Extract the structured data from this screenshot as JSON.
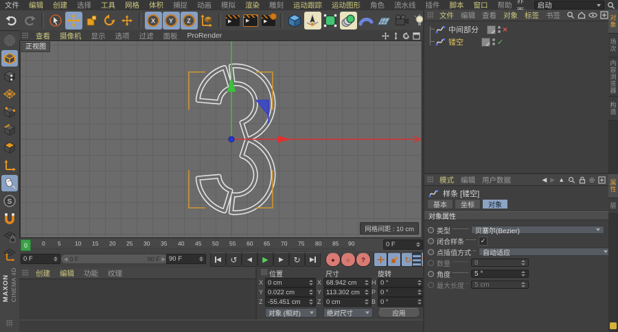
{
  "colors": {
    "accent_orange": "#d79b35",
    "selection_blue": "#87a0c4",
    "menu_highlight": "#cdc87e",
    "viewport_bg": "#6b6b6b",
    "axis_green": "#3fbf3f",
    "axis_red": "#e03030"
  },
  "menubar": {
    "items": [
      "文件",
      "编辑",
      "创建",
      "选择",
      "工具",
      "网格",
      "体积",
      "捕捉",
      "动画",
      "模拟",
      "渲染",
      "雕刻",
      "运动跟踪",
      "运动图形",
      "角色",
      "流水线",
      "插件",
      "脚本",
      "窗口",
      "帮助"
    ],
    "interface_label": "界面:",
    "interface_value": "启动"
  },
  "viewport": {
    "menu": [
      "查看",
      "摄像机",
      "显示",
      "选项",
      "过滤",
      "面板",
      "ProRender"
    ],
    "view_label": "正视图",
    "grid_spacing_label": "网格间距 : 10 cm"
  },
  "object_manager": {
    "menu": [
      "文件",
      "编辑",
      "查看",
      "对象",
      "标签",
      "书签"
    ],
    "objects": [
      {
        "name": "中间部分"
      },
      {
        "name": "镂空"
      }
    ],
    "side_tabs": [
      "对象",
      "场次",
      "内容浏览器",
      "构造"
    ]
  },
  "attribute_manager": {
    "menu": [
      "模式",
      "编辑",
      "用户数据"
    ],
    "title": "样条 [镂空]",
    "tabs": [
      "基本",
      "坐标",
      "对象"
    ],
    "section": "对象属性",
    "rows": [
      {
        "label": "类型",
        "value": "贝塞尔(Bezier)"
      },
      {
        "label": "闭合样条",
        "value": "✓"
      },
      {
        "label": "点插值方式",
        "value": "自动适应"
      },
      {
        "label": "数量",
        "value": "8"
      },
      {
        "label": "角度",
        "value": "5 °"
      },
      {
        "label": "最大长度",
        "value": "5 cm"
      }
    ],
    "side_tabs": [
      "属性",
      "层"
    ]
  },
  "timeline": {
    "ticks": [
      "0",
      "5",
      "10",
      "15",
      "20",
      "25",
      "30",
      "35",
      "40",
      "45",
      "50",
      "55",
      "60",
      "65",
      "70",
      "75",
      "80",
      "85",
      "90"
    ],
    "current": "0",
    "frame_field": "0 F",
    "range_start": "0 F",
    "range_end": "90 F",
    "end_field": "90 F",
    "ruler_field": "0 F"
  },
  "material_manager": {
    "menu": [
      "创建",
      "编辑",
      "功能",
      "纹理"
    ]
  },
  "coordinates": {
    "col_headers": [
      "位置",
      "尺寸",
      "旋转"
    ],
    "rows": [
      {
        "l1": "X",
        "v1": "0 cm",
        "l2": "X",
        "v2": "68.942 cm",
        "l3": "H",
        "v3": "0 °"
      },
      {
        "l1": "Y",
        "v1": "0.022 cm",
        "l2": "Y",
        "v2": "113.302 cm",
        "l3": "P",
        "v3": "0 °"
      },
      {
        "l1": "Z",
        "v1": "-55.451 cm",
        "l2": "Z",
        "v2": "0 cm",
        "l3": "B",
        "v3": "0 °"
      }
    ],
    "mode_position": "对象 (相对)",
    "mode_size": "绝对尺寸",
    "apply_label": "应用"
  },
  "brand": {
    "line1": "MAXON",
    "line2": "CINEMA 4D"
  }
}
